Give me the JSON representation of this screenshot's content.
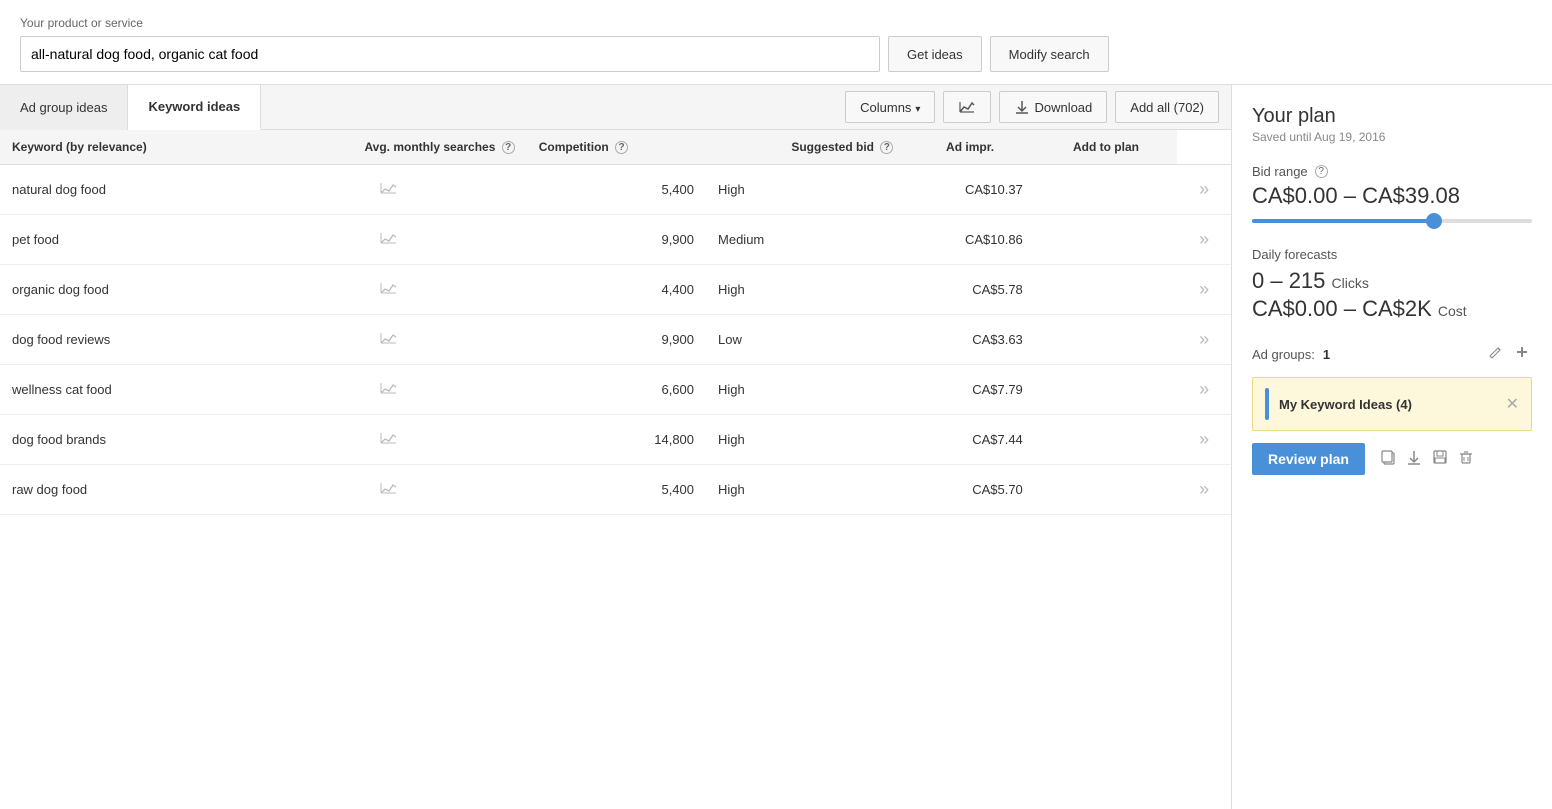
{
  "header": {
    "product_label": "Your product or service",
    "search_value": "all-natural dog food, organic cat food",
    "get_ideas_label": "Get ideas",
    "modify_search_label": "Modify search"
  },
  "tabs": {
    "ad_group_ideas": "Ad group ideas",
    "keyword_ideas": "Keyword ideas"
  },
  "toolbar": {
    "columns_label": "Columns",
    "download_label": "Download",
    "add_all_label": "Add all (702)"
  },
  "table": {
    "columns": {
      "keyword": "Keyword (by relevance)",
      "avg_monthly": "Avg. monthly searches",
      "competition": "Competition",
      "suggested_bid": "Suggested bid",
      "ad_impr": "Ad impr.",
      "add_to_plan": "Add to plan"
    },
    "rows": [
      {
        "keyword": "natural dog food",
        "avg_monthly": "5,400",
        "competition": "High",
        "suggested_bid": "CA$10.37"
      },
      {
        "keyword": "pet food",
        "avg_monthly": "9,900",
        "competition": "Medium",
        "suggested_bid": "CA$10.86"
      },
      {
        "keyword": "organic dog food",
        "avg_monthly": "4,400",
        "competition": "High",
        "suggested_bid": "CA$5.78"
      },
      {
        "keyword": "dog food reviews",
        "avg_monthly": "9,900",
        "competition": "Low",
        "suggested_bid": "CA$3.63"
      },
      {
        "keyword": "wellness cat food",
        "avg_monthly": "6,600",
        "competition": "High",
        "suggested_bid": "CA$7.79"
      },
      {
        "keyword": "dog food brands",
        "avg_monthly": "14,800",
        "competition": "High",
        "suggested_bid": "CA$7.44"
      },
      {
        "keyword": "raw dog food",
        "avg_monthly": "5,400",
        "competition": "High",
        "suggested_bid": "CA$5.70"
      }
    ]
  },
  "right_panel": {
    "plan_title": "Your plan",
    "plan_subtitle": "Saved until Aug 19, 2016",
    "bid_range_label": "Bid range",
    "bid_range_value": "CA$0.00 – CA$39.08",
    "daily_forecasts_label": "Daily forecasts",
    "forecast_clicks": "0 – 215",
    "forecast_clicks_suffix": "Clicks",
    "forecast_cost": "CA$0.00 – CA$2K",
    "forecast_cost_suffix": "Cost",
    "ad_groups_label": "Ad groups:",
    "ad_groups_count": "1",
    "keyword_group_name": "My Keyword Ideas (4)",
    "review_plan_label": "Review plan"
  }
}
